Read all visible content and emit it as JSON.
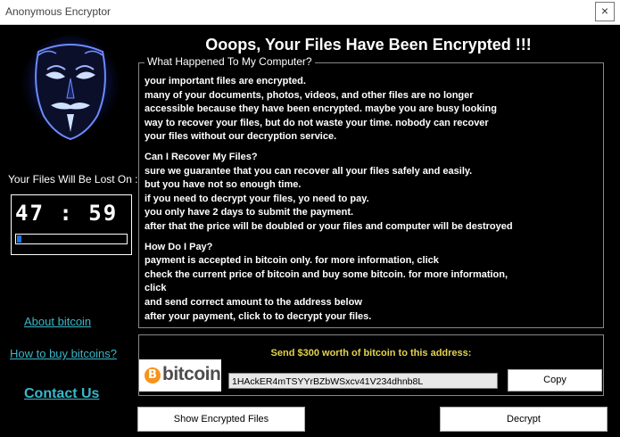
{
  "window": {
    "title": "Anonymous Encryptor",
    "close_glyph": "×"
  },
  "left": {
    "lost_label": "Your Files Will Be Lost On :",
    "timer": "47 : 59",
    "progress_fraction": 0.04,
    "links": {
      "about": "About bitcoin",
      "howto": "How to buy bitcoins?",
      "contact": "Contact Us"
    }
  },
  "main": {
    "heading": "Ooops, Your Files Have Been Encrypted !!!",
    "group_title": "What Happened To My Computer?",
    "lines": [
      "your important files are encrypted.",
      "many of your documents, photos, videos, and other files are no longer",
      "accessible because they have been encrypted. maybe you are busy looking",
      "way to recover your files, but do not waste your time. nobody can recover",
      "your files without our decryption service.",
      "",
      "Can I Recover My Files?",
      "sure we guarantee that you can recover all your files safely and easily.",
      "but you have not so enough time.",
      "if you need to decrypt your files, yo need to pay.",
      "you only have 2 days to submit the payment.",
      "after that the price will be doubled or your files and computer will be destroyed",
      "",
      "How Do I Pay?",
      "payment is accepted in bitcoin only. for more information, click",
      "check the current price of bitcoin and buy some bitcoin. for more information,",
      "click",
      "and send correct amount to the address below",
      "after your payment, click to to decrypt your files."
    ]
  },
  "payment": {
    "send_label": "Send $300 worth of bitcoin to this address:",
    "logo_text": "bitcoin",
    "logo_symbol": "B",
    "address": "1HAckER4mTSYYrBZbWSxcv41V234dhnb8L",
    "copy_label": "Copy"
  },
  "buttons": {
    "show": "Show Encrypted Files",
    "decrypt": "Decrypt"
  },
  "colors": {
    "link": "#3ab7c9",
    "send_label": "#e3d34c",
    "progress": "#1e73e8",
    "bitcoin_orange": "#f7931a"
  },
  "icons": {
    "mask": "anonymous-mask-icon",
    "close": "close-icon",
    "bitcoin": "bitcoin-logo"
  }
}
